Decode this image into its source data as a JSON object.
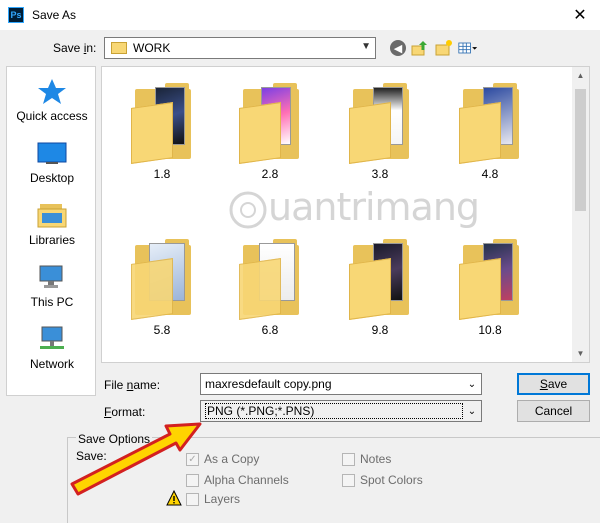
{
  "window": {
    "title": "Save As",
    "app_icon_text": "Ps",
    "close_glyph": "✕"
  },
  "savein": {
    "label_prefix": "Save ",
    "label_underlined": "i",
    "label_suffix": "n:",
    "value": "WORK"
  },
  "places": [
    {
      "label": "Quick access",
      "icon": "quick-access-star-icon"
    },
    {
      "label": "Desktop",
      "icon": "desktop-icon"
    },
    {
      "label": "Libraries",
      "icon": "libraries-icon"
    },
    {
      "label": "This PC",
      "icon": "computer-icon"
    },
    {
      "label": "Network",
      "icon": "network-icon"
    }
  ],
  "folders": [
    "1.8",
    "2.8",
    "3.8",
    "4.8",
    "5.8",
    "6.8",
    "9.8",
    "10.8"
  ],
  "watermark": "uantrimang",
  "filename": {
    "label_prefix": "File ",
    "label_underlined": "n",
    "label_suffix": "ame:",
    "value": "maxresdefault copy.png"
  },
  "format": {
    "label_underlined": "F",
    "label_suffix": "ormat:",
    "value": "PNG (*.PNG;*.PNS)"
  },
  "buttons": {
    "save_underlined": "S",
    "save_rest": "ave",
    "cancel": "Cancel"
  },
  "save_options": {
    "title": "Save Options",
    "save_label": "Save:",
    "as_a_copy": "As a Copy",
    "alpha_channels": "Alpha Channels",
    "layers": "Layers",
    "notes": "Notes",
    "spot_colors": "Spot Colors"
  },
  "colors": {
    "folder": "#f8d775",
    "accent": "#0078d7",
    "arrow": "#ffd400"
  }
}
